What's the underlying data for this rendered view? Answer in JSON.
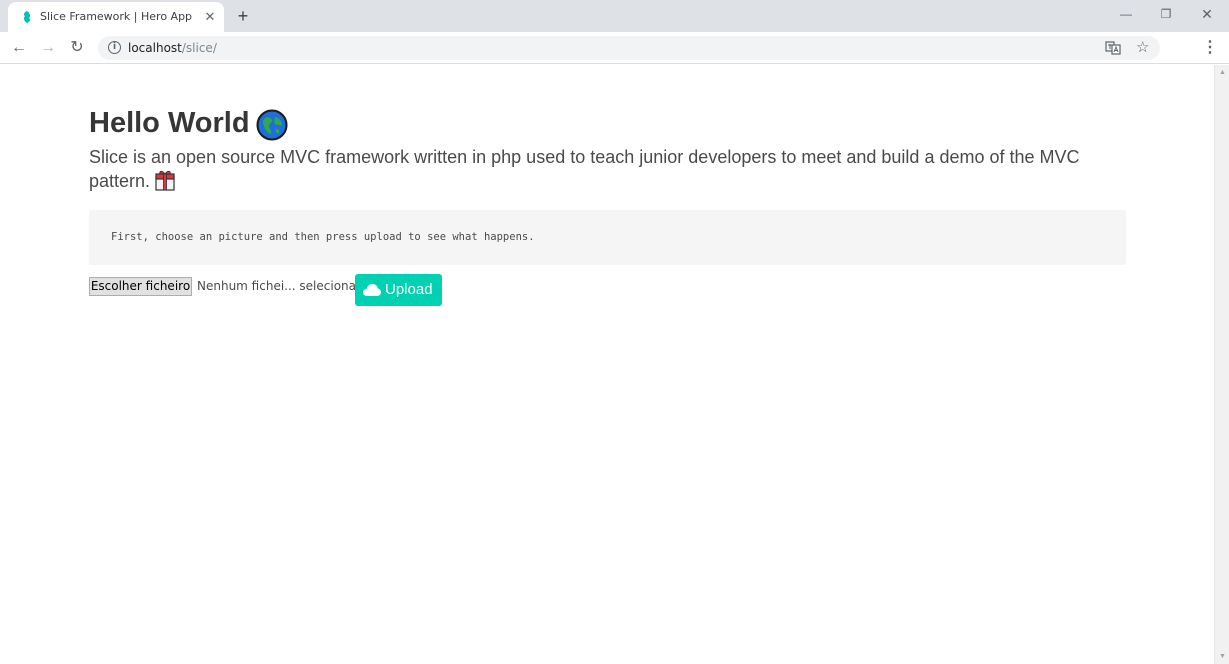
{
  "browser": {
    "tab_title": "Slice Framework | Hero App",
    "url_host": "localhost",
    "url_path": "/slice/"
  },
  "page": {
    "title": "Hello World",
    "lead": "Slice is an open source MVC framework written in php used to teach junior developers to meet and build a demo of the MVC pattern.",
    "instructions": "First, choose an picture and then press upload to see what happens.",
    "file_button": "Escolher ficheiro",
    "file_status": "Nenhum fichei... selecionado",
    "upload_button": "Upload"
  },
  "colors": {
    "accent": "#00d1b2",
    "text": "#363636"
  },
  "icons": [
    "slice-favicon-icon",
    "close-icon",
    "plus-icon",
    "back-icon",
    "forward-icon",
    "reload-icon",
    "info-icon",
    "translate-icon",
    "star-icon",
    "menu-icon",
    "globe-icon",
    "gift-icon",
    "cloud-icon"
  ]
}
